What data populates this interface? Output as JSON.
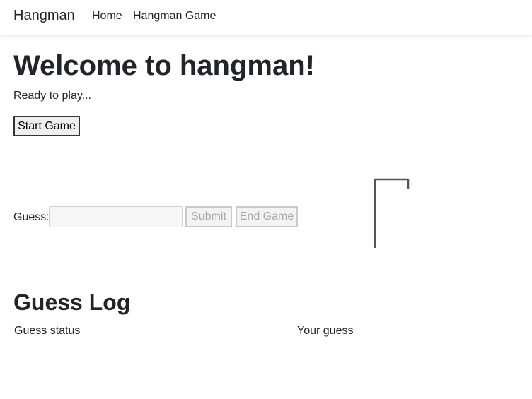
{
  "navbar": {
    "brand": "Hangman",
    "links": [
      {
        "label": "Home"
      },
      {
        "label": "Hangman Game"
      }
    ]
  },
  "main": {
    "title": "Welcome to hangman!",
    "status": "Ready to play...",
    "start_button": "Start Game"
  },
  "guess": {
    "label": "Guess:",
    "input_value": "",
    "submit_label": "Submit",
    "end_label": "End Game"
  },
  "gallows": {
    "wrong_guesses": 0
  },
  "log": {
    "title": "Guess Log",
    "columns": [
      "Guess status",
      "Your guess"
    ],
    "rows": []
  },
  "colors": {
    "text": "#212529",
    "disabled_text": "#a8a8a8",
    "gallows_line": "#555555"
  }
}
